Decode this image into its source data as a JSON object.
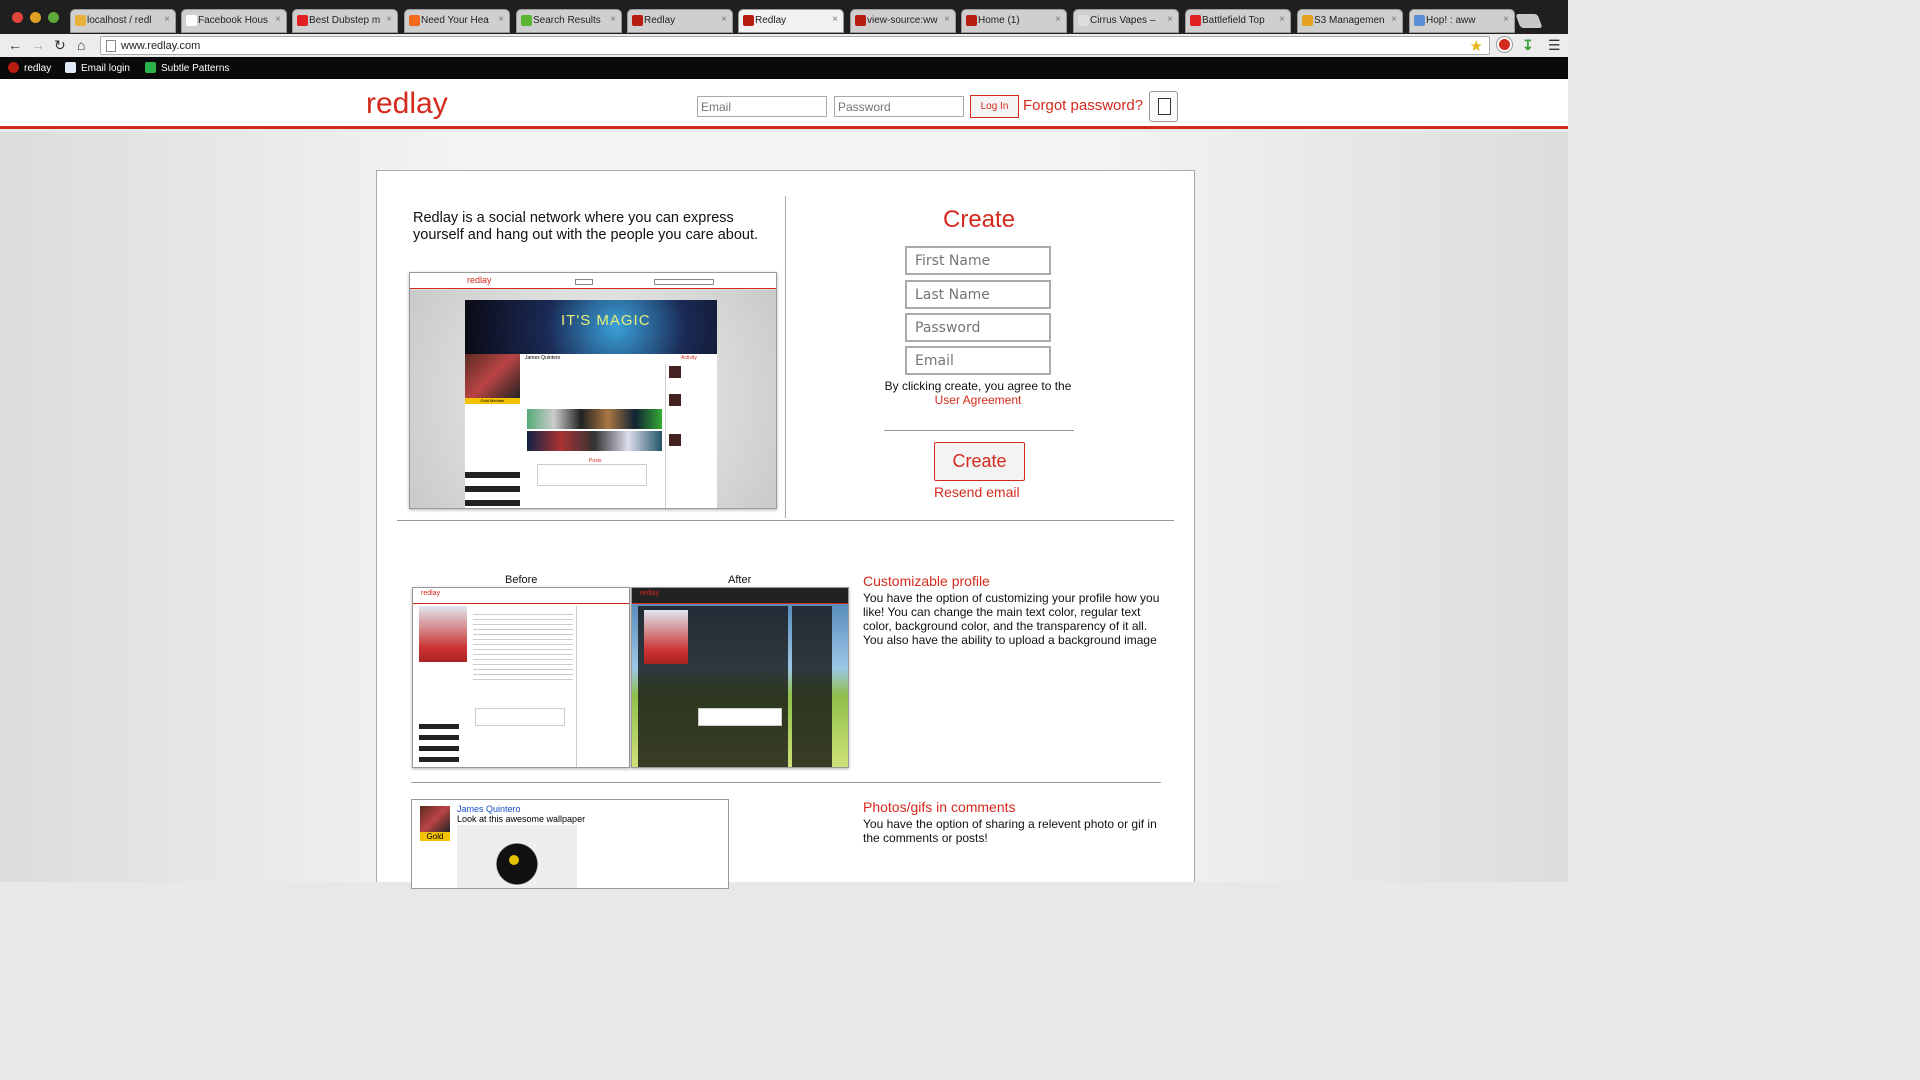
{
  "browser": {
    "tabs": [
      {
        "label": "localhost / redl",
        "fav": "#e8b23a"
      },
      {
        "label": "Facebook Hous",
        "fav": "#ffffff"
      },
      {
        "label": "Best Dubstep m",
        "fav": "#e02020"
      },
      {
        "label": "Need Your Hea",
        "fav": "#f26b1d"
      },
      {
        "label": "Search Results",
        "fav": "#5cb531"
      },
      {
        "label": "Redlay",
        "fav": "#b81d12"
      },
      {
        "label": "Redlay",
        "fav": "#b81d12"
      },
      {
        "label": "view-source:ww",
        "fav": "#b81d12"
      },
      {
        "label": "Home (1)",
        "fav": "#b81d12"
      },
      {
        "label": "Cirrus Vapes –",
        "fav": "#dddddd"
      },
      {
        "label": "Battlefield Top",
        "fav": "#e02020"
      },
      {
        "label": "S3 Managemen",
        "fav": "#e5a020"
      },
      {
        "label": "Hop! : aww",
        "fav": "#5a8fd8"
      }
    ],
    "url": "www.redlay.com",
    "bookmarks": [
      {
        "label": "redlay",
        "icon": "redlay-icon"
      },
      {
        "label": "Email login",
        "icon": "envelope-icon"
      },
      {
        "label": "Subtle Patterns",
        "icon": "patterns-icon"
      }
    ]
  },
  "header": {
    "logo": "redlay",
    "email_placeholder": "Email",
    "password_placeholder": "Password",
    "login_label": "Log In",
    "forgot_label": "Forgot password?"
  },
  "intro": {
    "text": "Redlay is a social network where you can express yourself and hang out with the people you care about."
  },
  "signup": {
    "title": "Create",
    "first_name_placeholder": "First Name",
    "last_name_placeholder": "Last Name",
    "password_placeholder": "Password",
    "email_placeholder": "Email",
    "agree_text": "By clicking create, you agree to the",
    "agreement_link": "User Agreement",
    "create_button": "Create",
    "resend_label": "Resend email"
  },
  "preview": {
    "logo": "redlay",
    "magic_text": "IT'S MAGIC",
    "profile_name": "James Quintero",
    "activity": "Activity",
    "posts": "Posts",
    "gold_member": "Gold Member"
  },
  "features": [
    {
      "title": "Customizable profile",
      "text": "You have the option of customizing your profile how you like! You can change the main text color, regular text color, background color, and the transparency of it all. You also have the ability to upload a background image",
      "before_label": "Before",
      "after_label": "After"
    },
    {
      "title": "Photos/gifs in comments",
      "text": "You have the option of sharing a relevent photo or gif in the comments or posts!",
      "comment_author": "James Quintero",
      "comment_text": "Look at this awesome wallpaper",
      "badge": "Gold"
    }
  ],
  "colors": {
    "brand": "#d42a1d"
  }
}
